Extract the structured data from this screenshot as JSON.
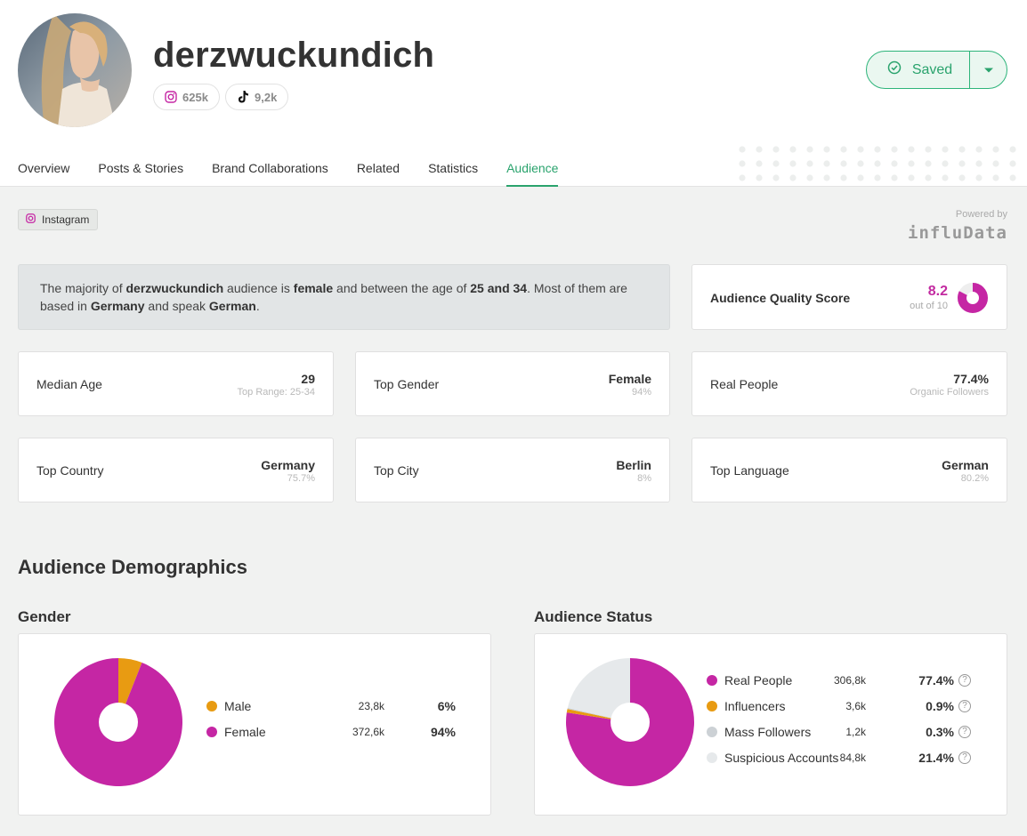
{
  "profile": {
    "username": "derzwuckundich",
    "instagram_followers": "625k",
    "tiktok_followers": "9,2k",
    "saved_label": "Saved"
  },
  "tabs": [
    {
      "label": "Overview",
      "active": false
    },
    {
      "label": "Posts & Stories",
      "active": false
    },
    {
      "label": "Brand Collaborations",
      "active": false
    },
    {
      "label": "Related",
      "active": false
    },
    {
      "label": "Statistics",
      "active": false
    },
    {
      "label": "Audience",
      "active": true
    }
  ],
  "platform_filter": "Instagram",
  "powered_by": {
    "label": "Powered by",
    "logo_text": "influData"
  },
  "summary": {
    "p1": "The majority of ",
    "name": "derzwuckundich",
    "p2": " audience is ",
    "gender": "female",
    "p3": " and between the age of ",
    "age": "25 and 34",
    "p4": ". Most of them are based in ",
    "country": "Germany",
    "p5": " and speak ",
    "language": "German",
    "p6": "."
  },
  "quality": {
    "label": "Audience Quality Score",
    "score": "8.2",
    "out_of": "out of 10",
    "value": 8.2,
    "max": 10
  },
  "stats": {
    "median_age": {
      "label": "Median Age",
      "value": "29",
      "sub": "Top Range: 25-34"
    },
    "top_gender": {
      "label": "Top Gender",
      "value": "Female",
      "sub": "94%"
    },
    "real_people": {
      "label": "Real People",
      "value": "77.4%",
      "sub": "Organic Followers"
    },
    "top_country": {
      "label": "Top Country",
      "value": "Germany",
      "sub": "75.7%"
    },
    "top_city": {
      "label": "Top City",
      "value": "Berlin",
      "sub": "8%"
    },
    "top_language": {
      "label": "Top Language",
      "value": "German",
      "sub": "80.2%"
    }
  },
  "demographics": {
    "title": "Audience Demographics",
    "gender": {
      "title": "Gender",
      "items": [
        {
          "name": "Male",
          "count": "23,8k",
          "pct": "6%",
          "value": 6,
          "color": "#e89b12"
        },
        {
          "name": "Female",
          "count": "372,6k",
          "pct": "94%",
          "value": 94,
          "color": "#c526a4"
        }
      ]
    },
    "status": {
      "title": "Audience Status",
      "items": [
        {
          "name": "Real People",
          "count": "306,8k",
          "pct": "77.4%",
          "value": 77.4,
          "color": "#c526a4"
        },
        {
          "name": "Influencers",
          "count": "3,6k",
          "pct": "0.9%",
          "value": 0.9,
          "color": "#e89b12"
        },
        {
          "name": "Mass Followers",
          "count": "1,2k",
          "pct": "0.3%",
          "value": 0.3,
          "color": "#ccd1d5"
        },
        {
          "name": "Suspicious Accounts",
          "count": "84,8k",
          "pct": "21.4%",
          "value": 21.4,
          "color": "#e6e9eb"
        }
      ]
    }
  },
  "colors": {
    "accent": "#2aa36d",
    "brand_magenta": "#c526a4",
    "orange": "#e89b12"
  }
}
